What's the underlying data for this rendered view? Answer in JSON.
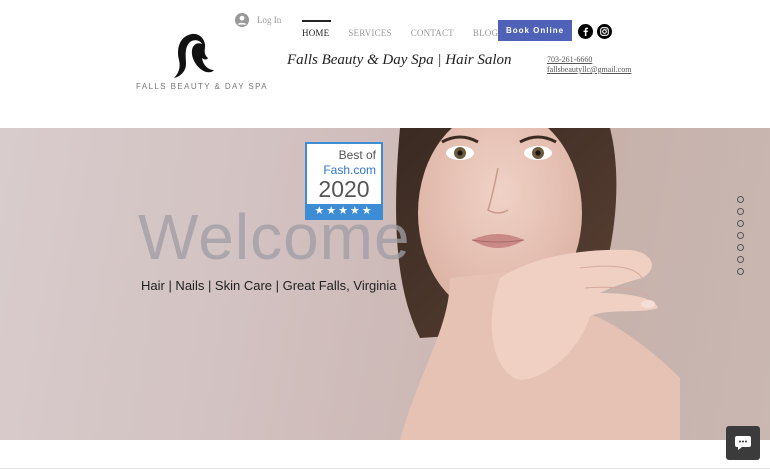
{
  "header": {
    "logo_text": "FALLS BEAUTY & DAY SPA",
    "login_label": "Log In",
    "nav": [
      "HOME",
      "SERVICES",
      "CONTACT",
      "BLOG"
    ],
    "active_nav": "HOME",
    "book_label": "Book Online",
    "site_title": "Falls Beauty & Day Spa | Hair Salon",
    "phone": "703-261-6660",
    "email": "fallsbeautyllc@gmail.com",
    "social_icons": [
      "facebook-icon",
      "instagram-icon"
    ]
  },
  "hero": {
    "badge": {
      "line1": "Best of",
      "line2": "Fash.com",
      "year": "2020",
      "stars": "★★★★★"
    },
    "welcome": "Welcome",
    "tagline": "Hair | Nails | Skin Care | Great Falls, Virginia",
    "slide_count": 7
  },
  "colors": {
    "accent": "#4f62b8",
    "badge_blue": "#3d8cd6"
  }
}
